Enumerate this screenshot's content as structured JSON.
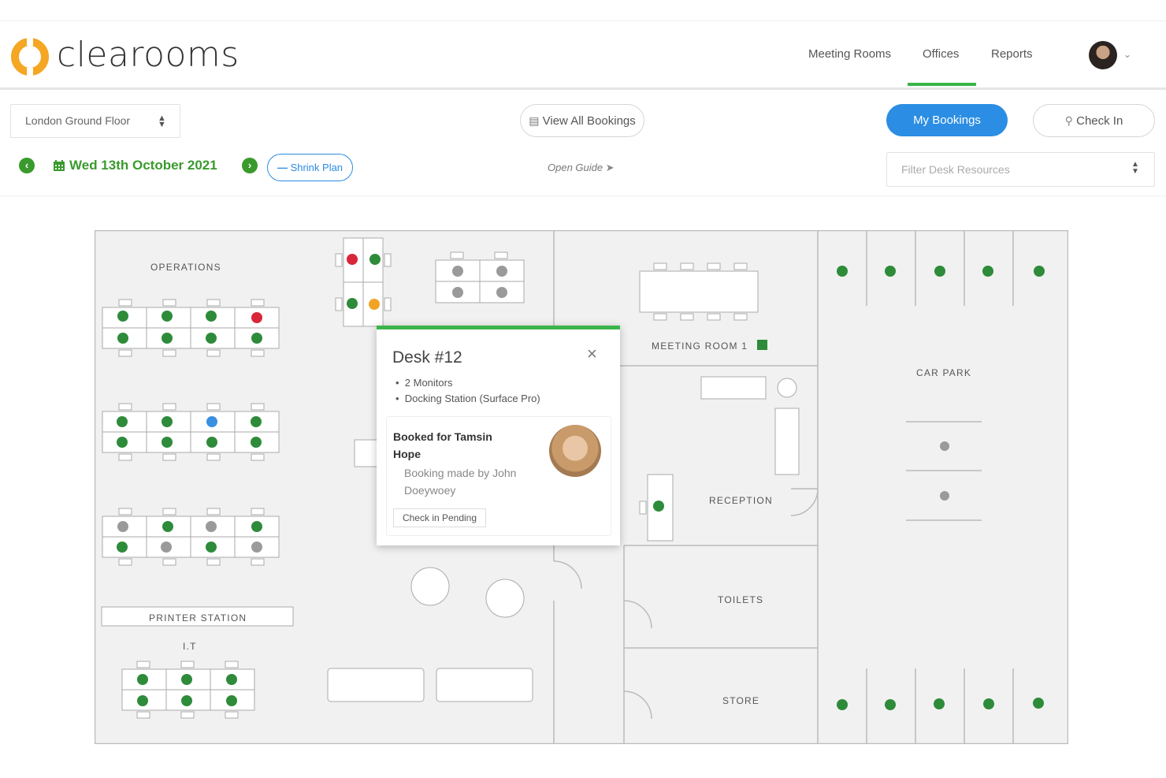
{
  "header": {
    "brand": "clearooms",
    "nav": [
      {
        "label": "Meeting Rooms",
        "active": false
      },
      {
        "label": "Offices",
        "active": true
      },
      {
        "label": "Reports",
        "active": false
      }
    ],
    "accent_color": "#3bb54a",
    "logo_color": "#f5a623"
  },
  "toolbar": {
    "location": "London Ground Floor",
    "view_all": "View All Bookings",
    "my_bookings": "My Bookings",
    "check_in": "Check In",
    "date": "Wed 13th October 2021",
    "shrink": "Shrink Plan",
    "guide": "Open Guide",
    "filter_placeholder": "Filter Desk Resources",
    "primary_color": "#2b8de3",
    "date_color": "#3a9a2d"
  },
  "plan": {
    "labels": {
      "operations": "OPERATIONS",
      "meeting_room": "MEETING ROOM 1",
      "car_park": "CAR PARK",
      "reception": "RECEPTION",
      "toilets": "TOILETS",
      "store": "STORE",
      "printer": "PRINTER STATION",
      "it": "I.T"
    },
    "status_colors": {
      "available": "#2e8b3a",
      "booked": "#d9263a",
      "pending": "#f0a325",
      "mine": "#3b8fe0",
      "unavailable": "#9a9a9a"
    }
  },
  "popup": {
    "title": "Desk #12",
    "features": [
      "2 Monitors",
      "Docking Station (Surface Pro)"
    ],
    "booked_for": "Booked for Tamsin Hope",
    "made_by": "Booking made by John Doeywoey",
    "status": "Check in Pending"
  }
}
